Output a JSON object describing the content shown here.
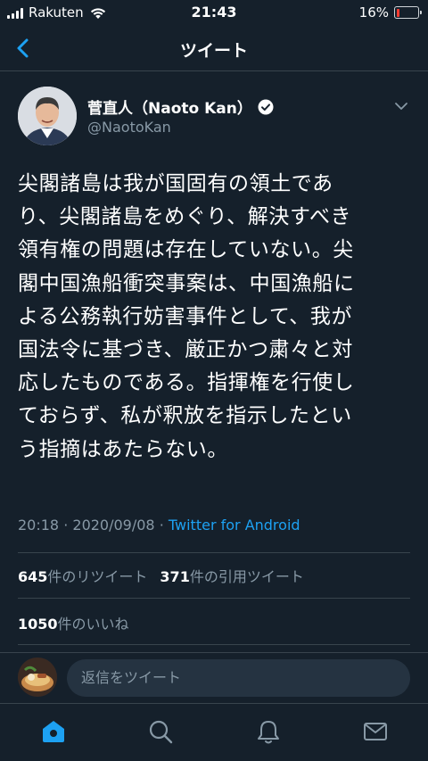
{
  "status_bar": {
    "carrier": "Rakuten",
    "time": "21:43",
    "battery": "16%",
    "battery_level": 0.16
  },
  "header": {
    "title": "ツイート"
  },
  "tweet": {
    "display_name": "菅直人（Naoto Kan）",
    "handle": "@NaotoKan",
    "verified": true,
    "text": "尖閣諸島は我が国固有の領土であ\nり、尖閣諸島をめぐり、解決すべき\n領有権の問題は存在していない。尖\n閣中国漁船衝突事案は、中国漁船に\nよる公務執行妨害事件として、我が\n国法令に基づき、厳正かつ粛々と対\n応したものである。指揮権を行使し\nておらず、私が釈放を指示したとい\nう指摘はあたらない。",
    "time": "20:18",
    "date": "2020/09/08",
    "dot": "·",
    "source": "Twitter for Android",
    "retweets": "645",
    "retweets_label": "件のリツイート",
    "quotes": "371",
    "quotes_label": "件の引用ツイート",
    "likes": "1050",
    "likes_label": "件のいいね"
  },
  "reply": {
    "placeholder": "返信をツイート"
  },
  "tabs": [
    "home",
    "search",
    "notifications",
    "messages"
  ],
  "colors": {
    "background": "#15202b",
    "accent": "#1da1f2",
    "muted": "#8899a6",
    "divider": "#38444d"
  }
}
